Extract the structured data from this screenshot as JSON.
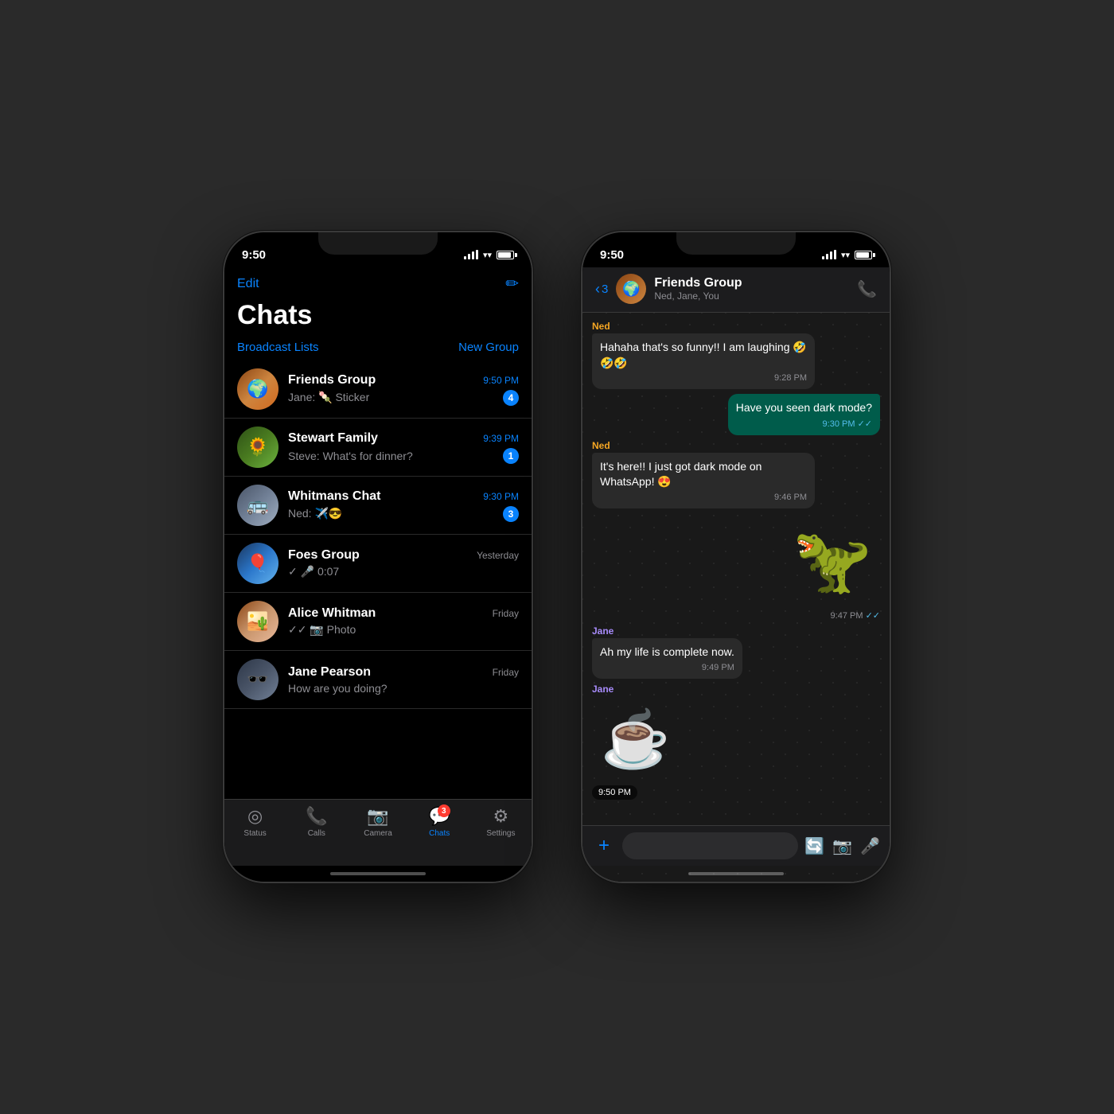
{
  "background": "#2a2a2a",
  "phone_left": {
    "status_bar": {
      "time": "9:50",
      "signal": "full",
      "wifi": "on",
      "battery": "full"
    },
    "header": {
      "edit_label": "Edit",
      "compose_label": "✏"
    },
    "title": "Chats",
    "links": {
      "broadcast": "Broadcast Lists",
      "new_group": "New Group"
    },
    "chats": [
      {
        "id": "friends-group",
        "name": "Friends Group",
        "time": "9:50 PM",
        "preview": "Jane: 🧆 Sticker",
        "badge": "4",
        "time_blue": true
      },
      {
        "id": "stewart-family",
        "name": "Stewart Family",
        "time": "9:39 PM",
        "preview": "Steve: What's for dinner?",
        "badge": "1",
        "time_blue": true
      },
      {
        "id": "whitmans-chat",
        "name": "Whitmans Chat",
        "time": "9:30 PM",
        "preview": "Ned: ✈️😎",
        "badge": "3",
        "time_blue": true
      },
      {
        "id": "foes-group",
        "name": "Foes Group",
        "time": "Yesterday",
        "preview": "✓🎤 0:07",
        "badge": "",
        "time_blue": false
      },
      {
        "id": "alice-whitman",
        "name": "Alice Whitman",
        "time": "Friday",
        "preview": "✓✓ 📷 Photo",
        "badge": "",
        "time_blue": false
      },
      {
        "id": "jane-pearson",
        "name": "Jane Pearson",
        "time": "Friday",
        "preview": "How are you doing?",
        "badge": "",
        "time_blue": false
      }
    ],
    "tab_bar": {
      "items": [
        {
          "id": "status",
          "icon": "◎",
          "label": "Status",
          "active": false,
          "badge": ""
        },
        {
          "id": "calls",
          "icon": "📞",
          "label": "Calls",
          "active": false,
          "badge": ""
        },
        {
          "id": "camera",
          "icon": "📷",
          "label": "Camera",
          "active": false,
          "badge": ""
        },
        {
          "id": "chats",
          "icon": "💬",
          "label": "Chats",
          "active": true,
          "badge": "3"
        },
        {
          "id": "settings",
          "icon": "⚙",
          "label": "Settings",
          "active": false,
          "badge": ""
        }
      ]
    }
  },
  "phone_right": {
    "status_bar": {
      "time": "9:50",
      "signal": "full",
      "wifi": "on",
      "battery": "full"
    },
    "header": {
      "back_count": "3",
      "group_name": "Friends Group",
      "group_members": "Ned, Jane, You"
    },
    "messages": [
      {
        "type": "received",
        "sender": "Ned",
        "sender_color": "orange",
        "text": "Hahaha that's so funny!! I am laughing 🤣🤣🤣",
        "time": "9:28 PM",
        "checks": ""
      },
      {
        "type": "sent",
        "text": "Have you seen dark mode?",
        "time": "9:30 PM",
        "checks": "✓✓"
      },
      {
        "type": "received",
        "sender": "Ned",
        "sender_color": "orange",
        "text": "It's here!! I just got dark mode on WhatsApp! 😍",
        "time": "9:46 PM",
        "checks": ""
      },
      {
        "type": "sticker-sent",
        "emoji": "🦕",
        "time": "9:47 PM",
        "checks": "✓✓"
      },
      {
        "type": "received",
        "sender": "Jane",
        "sender_color": "purple",
        "text": "Ah my life is complete now.",
        "time": "9:49 PM",
        "checks": ""
      },
      {
        "type": "sticker-received",
        "sender": "Jane",
        "sender_color": "purple",
        "emoji": "☕",
        "time": "9:50 PM"
      }
    ],
    "input_bar": {
      "placeholder": ""
    }
  }
}
